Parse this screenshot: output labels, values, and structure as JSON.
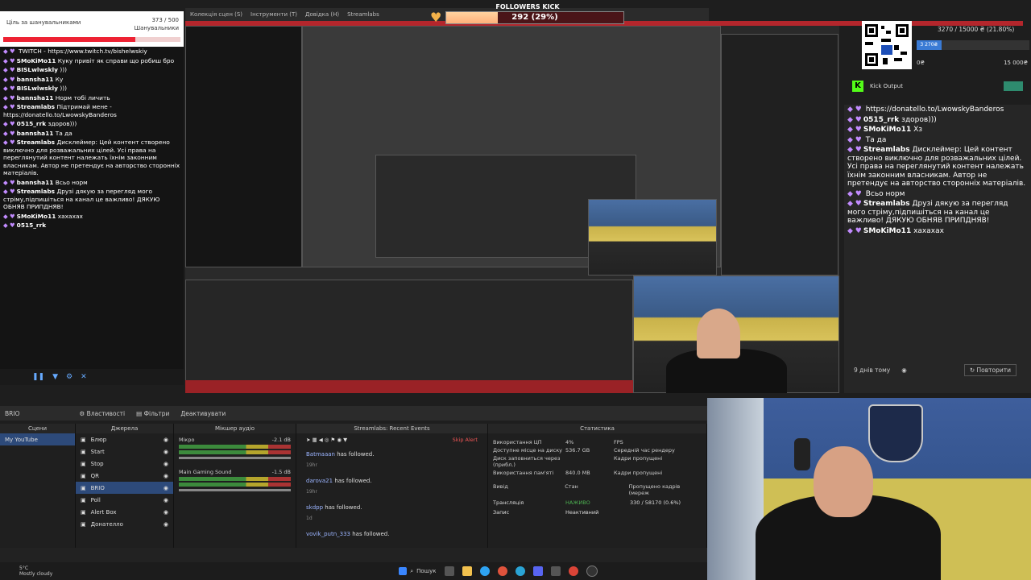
{
  "goal": {
    "title": "Ціль за шанувальниками",
    "count": "373 / 500",
    "sub": "Шанувальники",
    "progress": 0.746
  },
  "followers_kick": {
    "title": "FOLLOWERS KICK",
    "value": "292 (29%)",
    "min": "0",
    "max": "1000",
    "progress": 0.29
  },
  "menubar": {
    "items": [
      "Колекція сцен (S)",
      "Інструменти (Т)",
      "Довідка (Н)",
      "Streamlabs"
    ]
  },
  "chat": {
    "messages": [
      {
        "user": "",
        "text": "TWITCH - https://www.twitch.tv/bishelwskiy"
      },
      {
        "user": "SMoKiMo11",
        "text": "Куку привіт як справи що робиш бро"
      },
      {
        "user": "BISLwlwskly",
        "text": ")))"
      },
      {
        "user": "bannsha11",
        "text": "Ку"
      },
      {
        "user": "BISLwlwskly",
        "text": ")))"
      },
      {
        "user": "bannsha11",
        "text": "Норм тобі личить"
      },
      {
        "user": "Streamlabs",
        "text": "Підтримай мене - https://donatello.to/LwowskyBanderos"
      },
      {
        "user": "0515_rrk",
        "text": "здоров)))"
      },
      {
        "user": "bannsha11",
        "text": "Та да"
      },
      {
        "user": "Streamlabs",
        "text": "Дисклеймер: Цей контент створено виключно для розважальних цілей. Усі права на переглянутий контент належать їхнім законним власникам. Автор не претендує на авторство сторонніх матеріалів."
      },
      {
        "user": "bannsha11",
        "text": "Всьо норм"
      },
      {
        "user": "Streamlabs",
        "text": "Друзі дякую за перегляд мого стріму,підпишіться на канал це важливо! ДЯКУЮ ОБНЯВ ПРИПДНЯВ!"
      },
      {
        "user": "SMoKiMo11",
        "text": "хахахах"
      },
      {
        "user": "0515_rrk",
        "text": ""
      }
    ]
  },
  "obs": {
    "toolbar": {
      "scene": "BRIO",
      "properties": "Властивості",
      "filters": "Фільтри",
      "deactivate": "Деактивувати"
    },
    "panels": {
      "scenes": "Сцени",
      "sources": "Джерела",
      "mixer": "Мікшер аудіо",
      "events": "Streamlabs: Recent Events",
      "stats": "Статистика"
    },
    "scenes": [
      "My YouTube"
    ],
    "sources": [
      "Блюр",
      "Start",
      "Stop",
      "QR",
      "BRIO",
      "Poll",
      "Alert Box",
      "Донателло"
    ],
    "mixer": [
      {
        "name": "Мікро",
        "db": "-2.1 dB"
      },
      {
        "name": "Main Gaming Sound",
        "db": "-1.5 dB"
      }
    ],
    "events": [
      {
        "name": "Batmaaan",
        "action": "has followed.",
        "time": "19hr"
      },
      {
        "name": "darova21",
        "action": "has followed.",
        "time": "19hr"
      },
      {
        "name": "skdpp",
        "action": "has followed.",
        "time": "1d"
      },
      {
        "name": "vovik_putn_333",
        "action": "has followed.",
        "time": ""
      }
    ],
    "events_skip": "Skip Alert",
    "stats": [
      {
        "k": "Використання ЦП",
        "v": "4%",
        "k2": "FPS"
      },
      {
        "k": "Доступне місце на диску",
        "v": "536.7 GB",
        "k2": "Середній час рендеру"
      },
      {
        "k": "Диск заповниться через (прибл.)",
        "v": "",
        "k2": "Кадри пропущені"
      },
      {
        "k": "Використання пам'яті",
        "v": "840.0 MB",
        "k2": "Кадри пропущені"
      }
    ],
    "stats_table": {
      "h1": "Вивід",
      "h2": "Стан",
      "h3": "Пропущено кадрів (мереж",
      "r1": [
        "Трансляція",
        "НАЖИВО",
        "330 / 58170 (0.6%)"
      ],
      "r2": [
        "Запис",
        "Неактивний",
        ""
      ]
    }
  },
  "donate": {
    "value": "3270 / 15000 ₴ (21.80%)",
    "badge": "3 270₴",
    "lo": "0₴",
    "hi": "15 000₴",
    "progress": 0.218
  },
  "kick": {
    "title": "Kick Output"
  },
  "rchat": {
    "messages": [
      {
        "user": "",
        "text": "https://donatello.to/LwowskyBanderos"
      },
      {
        "user": "0515_rrk",
        "text": "здоров)))"
      },
      {
        "user": "SMoKiMo11",
        "text": "Хз"
      },
      {
        "user": "",
        "text": "Та да"
      },
      {
        "user": "Streamlabs",
        "text": "Дисклеймер: Цей контент створено виключно для розважальних цілей. Усі права на переглянутий контент належать їхнім законним власникам. Автор не претендує на авторство сторонніх матеріалів."
      },
      {
        "user": "",
        "text": "Всьо норм"
      },
      {
        "user": "Streamlabs",
        "text": "Друзі дякую за перегляд мого стріму,підпишіться на канал це важливо! ДЯКУЮ ОБНЯВ ПРИПДНЯВ!"
      },
      {
        "user": "SMoKiMo11",
        "text": "хахахах"
      }
    ],
    "footer_time": "9 днів тому",
    "retry": "Повторити"
  },
  "taskbar": {
    "temp": "5°C",
    "weather": "Mostly cloudy",
    "search": "Пошук"
  }
}
